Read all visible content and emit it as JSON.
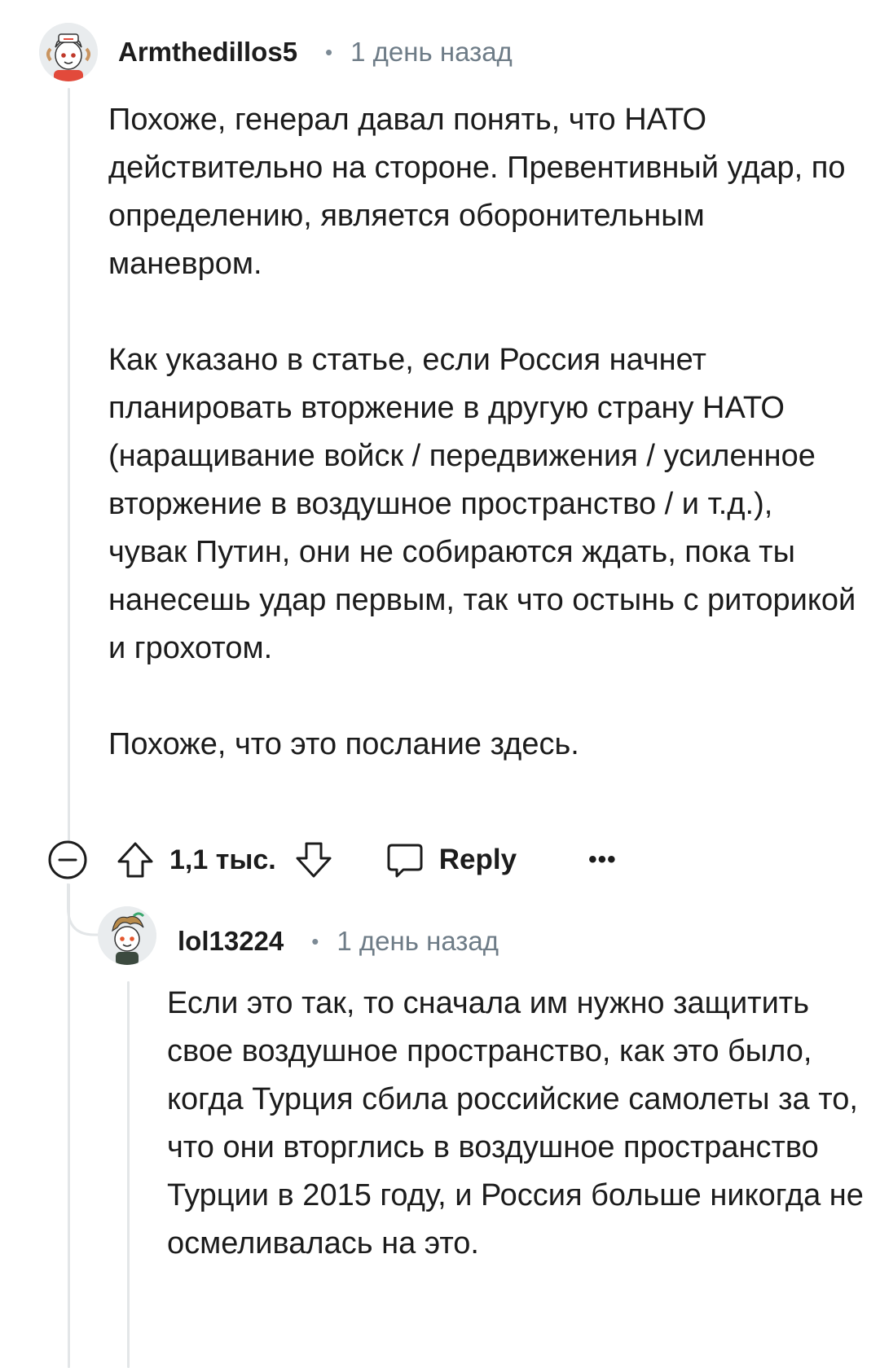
{
  "comments": [
    {
      "username": "Armthedillos5",
      "separator": "•",
      "timestamp": "1 день назад",
      "paragraphs": [
        "Похоже, генерал давал понять, что НАТО действительно на стороне. Превентивный удар, по определению, является оборонительным маневром.",
        "Как указано в статье, если Россия начнет планировать вторжение в другую страну НАТО (наращивание войск / передвижения / усиленное вторжение в воздушное пространство / и т.д.), чувак Путин, они не собираются ждать, пока ты нанесешь удар первым, так что остынь с риторикой и грохотом.",
        "Похоже, что это послание здесь."
      ],
      "actions": {
        "vote_count": "1,1 тыс.",
        "reply_label": "Reply",
        "more_label": "•••"
      }
    },
    {
      "username": "lol13224",
      "separator": "•",
      "timestamp": "1 день назад",
      "paragraphs": [
        "Если это так, то сначала им нужно защитить свое воздушное пространство, как это было, когда Турция сбила российские самолеты за то, что они вторглись в воздушное пространство Турции в 2015 году, и Россия больше никогда не осмеливалась на это."
      ]
    }
  ],
  "icons": {
    "collapse": "minus-circle-icon",
    "upvote": "arrow-up-icon",
    "downvote": "arrow-down-icon",
    "reply": "speech-bubble-icon",
    "more": "ellipsis-icon"
  }
}
